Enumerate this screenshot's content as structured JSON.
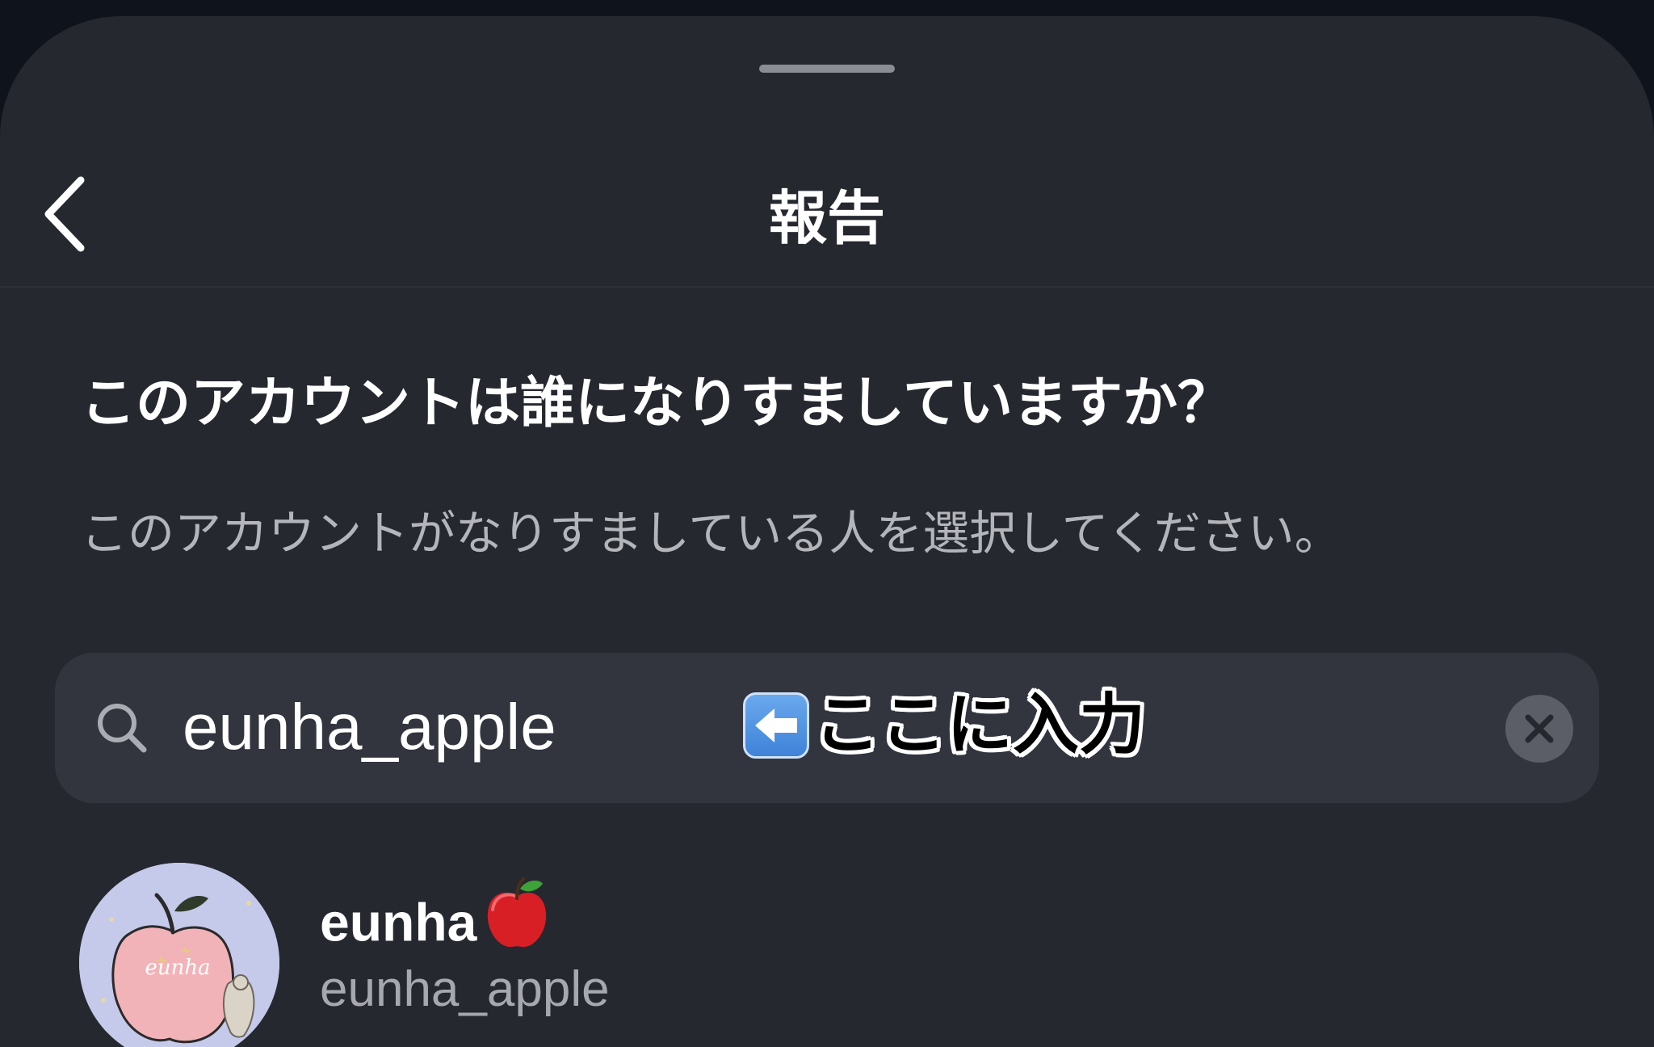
{
  "header": {
    "title": "報告"
  },
  "question": {
    "heading": "このアカウントは誰になりすましていますか？",
    "instruction": "このアカウントがなりすましている人を選択してください。"
  },
  "search": {
    "value": "eunha_apple",
    "placeholder": "",
    "annotation": "ここに入力"
  },
  "results": [
    {
      "display_name": "eunha",
      "username": "eunha_apple",
      "avatar_text": "eunha"
    }
  ],
  "icons": {
    "back": "chevron-left-icon",
    "search": "search-icon",
    "clear": "clear-icon",
    "annotation_arrow": "left-arrow-icon",
    "name_emoji": "red-apple-icon"
  },
  "colors": {
    "background": "#262830",
    "search_box": "#32353e",
    "text_primary": "#ffffff",
    "text_secondary": "#b3b5bb"
  }
}
